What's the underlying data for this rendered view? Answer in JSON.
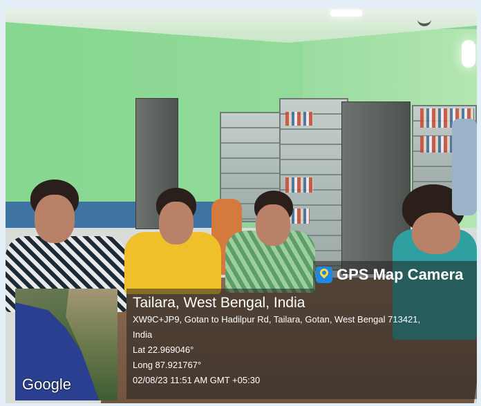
{
  "overlay": {
    "app_name": "GPS Map Camera",
    "place": "Tailara, West Bengal, India",
    "address_line1": "XW9C+JP9, Gotan to Hadilpur Rd, Tailara, Gotan, West Bengal 713421,",
    "address_line2": "India",
    "latitude": "Lat 22.969046°",
    "longitude": "Long 87.921767°",
    "datetime": "02/08/23 11:51 AM GMT +05:30"
  },
  "map": {
    "provider_label": "Google"
  },
  "icons": {
    "app_icon": "map-pin-icon"
  }
}
